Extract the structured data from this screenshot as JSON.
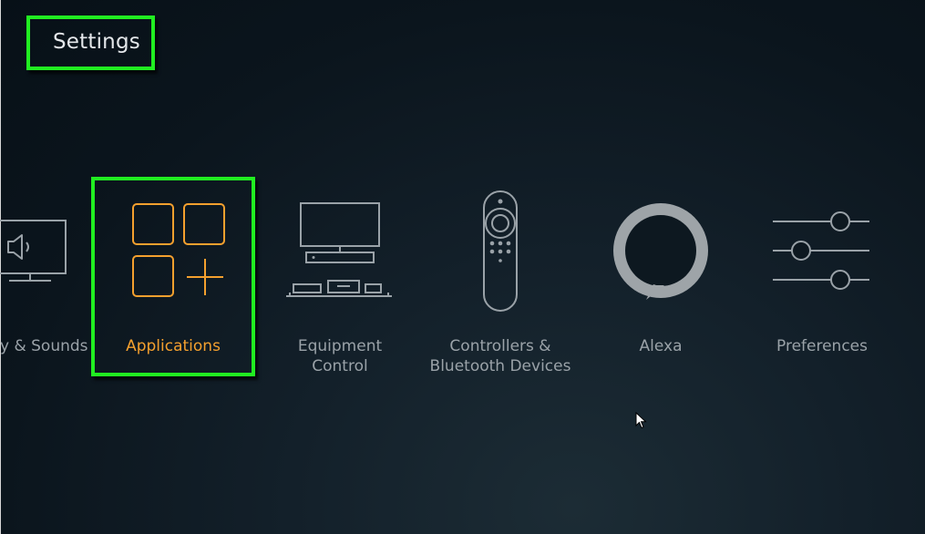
{
  "header": {
    "title": "Settings"
  },
  "menu": {
    "items": [
      {
        "label": "y & Sounds",
        "icon": "tv-speaker-icon"
      },
      {
        "label": "Applications",
        "icon": "applications-grid-icon",
        "selected": true
      },
      {
        "label_line1": "Equipment",
        "label_line2": "Control",
        "icon": "equipment-icon"
      },
      {
        "label_line1": "Controllers &",
        "label_line2": "Bluetooth Devices",
        "icon": "remote-icon"
      },
      {
        "label": "Alexa",
        "icon": "alexa-icon"
      },
      {
        "label": "Preferences",
        "icon": "sliders-icon"
      }
    ]
  },
  "colors": {
    "focus_border": "#21ee21",
    "selected_label": "#f4a02e",
    "icon_gray": "#9aa2a8",
    "background": "#0b151d"
  }
}
